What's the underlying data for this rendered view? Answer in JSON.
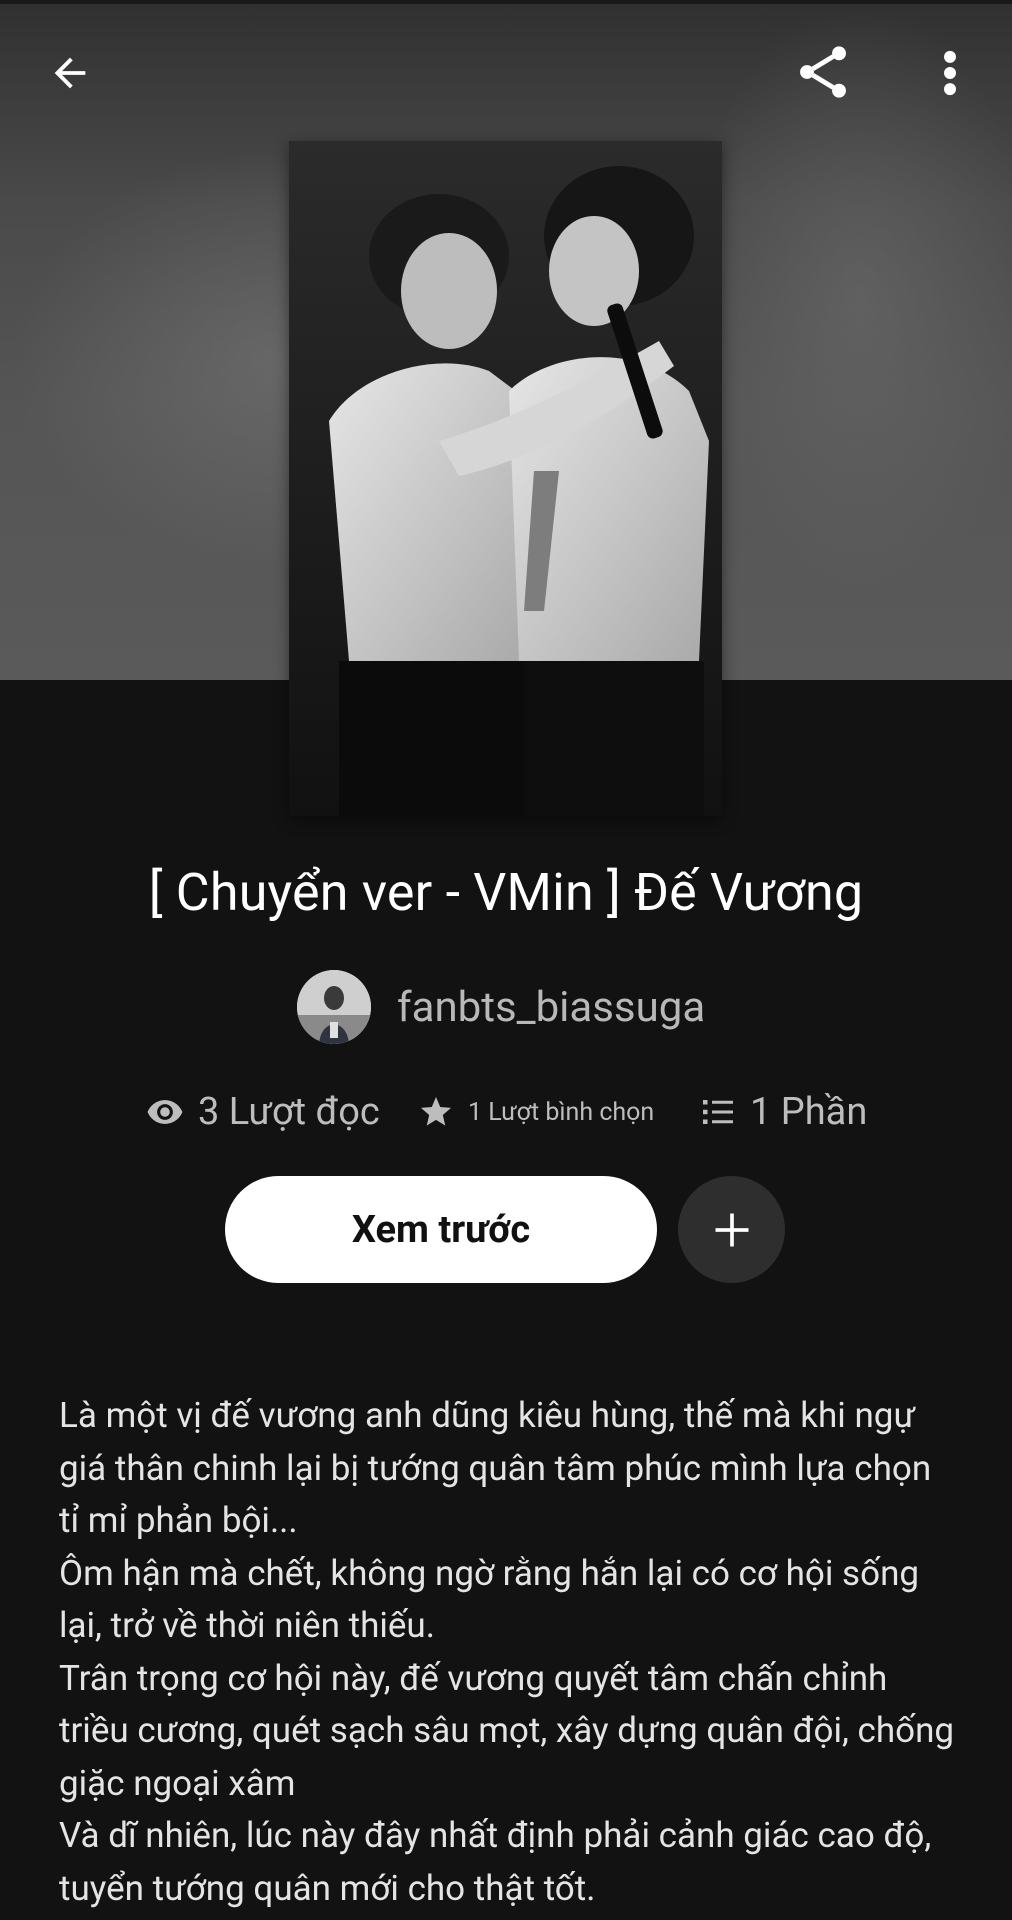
{
  "header": {
    "back_icon": "arrow-left-icon",
    "share_icon": "share-icon",
    "more_icon": "more-vertical-icon"
  },
  "story": {
    "cover_image": "story-cover-two-performers-white-shirts",
    "title": "[ Chuyển ver - VMin ] Đế Vương",
    "author": "fanbts_biassuga"
  },
  "stats": {
    "reads": "3 Lượt đọc",
    "votes": "1 Lượt bình chọn",
    "parts": "1 Phần"
  },
  "actions": {
    "preview_label": "Xem trước",
    "add_icon": "plus-icon"
  },
  "description": {
    "lines": [
      "Là một vị đế vương anh dũng kiêu hùng, thế mà khi ngự giá thân chinh lại bị tướng quân tâm phúc mình lựa chọn tỉ mỉ phản bội...",
      "Ôm hận mà chết, không ngờ rằng hắn lại có cơ hội sống lại, trở về thời niên thiếu.",
      "Trân trọng cơ hội này, đế vương quyết tâm chấn chỉnh triều cương, quét sạch sâu mọt, xây dựng quân đội, chống giặc ngoại xâm",
      "Và dĩ nhiên, lúc này đây nhất định phải cảnh giác cao độ, tuyển tướng quân mới cho thật tốt."
    ]
  },
  "colors": {
    "background": "#121212",
    "primary_button": "#ffffff",
    "secondary_button": "#2e2e2e",
    "muted_text": "#bdbdbd"
  }
}
